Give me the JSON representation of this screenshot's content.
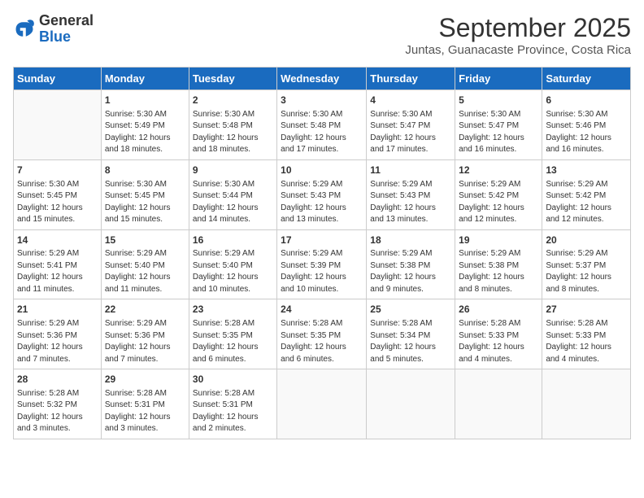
{
  "header": {
    "logo_line1": "General",
    "logo_line2": "Blue",
    "title": "September 2025",
    "subtitle": "Juntas, Guanacaste Province, Costa Rica"
  },
  "days_of_week": [
    "Sunday",
    "Monday",
    "Tuesday",
    "Wednesday",
    "Thursday",
    "Friday",
    "Saturday"
  ],
  "weeks": [
    [
      {
        "day": "",
        "info": ""
      },
      {
        "day": "1",
        "info": "Sunrise: 5:30 AM\nSunset: 5:49 PM\nDaylight: 12 hours\nand 18 minutes."
      },
      {
        "day": "2",
        "info": "Sunrise: 5:30 AM\nSunset: 5:48 PM\nDaylight: 12 hours\nand 18 minutes."
      },
      {
        "day": "3",
        "info": "Sunrise: 5:30 AM\nSunset: 5:48 PM\nDaylight: 12 hours\nand 17 minutes."
      },
      {
        "day": "4",
        "info": "Sunrise: 5:30 AM\nSunset: 5:47 PM\nDaylight: 12 hours\nand 17 minutes."
      },
      {
        "day": "5",
        "info": "Sunrise: 5:30 AM\nSunset: 5:47 PM\nDaylight: 12 hours\nand 16 minutes."
      },
      {
        "day": "6",
        "info": "Sunrise: 5:30 AM\nSunset: 5:46 PM\nDaylight: 12 hours\nand 16 minutes."
      }
    ],
    [
      {
        "day": "7",
        "info": "Sunrise: 5:30 AM\nSunset: 5:45 PM\nDaylight: 12 hours\nand 15 minutes."
      },
      {
        "day": "8",
        "info": "Sunrise: 5:30 AM\nSunset: 5:45 PM\nDaylight: 12 hours\nand 15 minutes."
      },
      {
        "day": "9",
        "info": "Sunrise: 5:30 AM\nSunset: 5:44 PM\nDaylight: 12 hours\nand 14 minutes."
      },
      {
        "day": "10",
        "info": "Sunrise: 5:29 AM\nSunset: 5:43 PM\nDaylight: 12 hours\nand 13 minutes."
      },
      {
        "day": "11",
        "info": "Sunrise: 5:29 AM\nSunset: 5:43 PM\nDaylight: 12 hours\nand 13 minutes."
      },
      {
        "day": "12",
        "info": "Sunrise: 5:29 AM\nSunset: 5:42 PM\nDaylight: 12 hours\nand 12 minutes."
      },
      {
        "day": "13",
        "info": "Sunrise: 5:29 AM\nSunset: 5:42 PM\nDaylight: 12 hours\nand 12 minutes."
      }
    ],
    [
      {
        "day": "14",
        "info": "Sunrise: 5:29 AM\nSunset: 5:41 PM\nDaylight: 12 hours\nand 11 minutes."
      },
      {
        "day": "15",
        "info": "Sunrise: 5:29 AM\nSunset: 5:40 PM\nDaylight: 12 hours\nand 11 minutes."
      },
      {
        "day": "16",
        "info": "Sunrise: 5:29 AM\nSunset: 5:40 PM\nDaylight: 12 hours\nand 10 minutes."
      },
      {
        "day": "17",
        "info": "Sunrise: 5:29 AM\nSunset: 5:39 PM\nDaylight: 12 hours\nand 10 minutes."
      },
      {
        "day": "18",
        "info": "Sunrise: 5:29 AM\nSunset: 5:38 PM\nDaylight: 12 hours\nand 9 minutes."
      },
      {
        "day": "19",
        "info": "Sunrise: 5:29 AM\nSunset: 5:38 PM\nDaylight: 12 hours\nand 8 minutes."
      },
      {
        "day": "20",
        "info": "Sunrise: 5:29 AM\nSunset: 5:37 PM\nDaylight: 12 hours\nand 8 minutes."
      }
    ],
    [
      {
        "day": "21",
        "info": "Sunrise: 5:29 AM\nSunset: 5:36 PM\nDaylight: 12 hours\nand 7 minutes."
      },
      {
        "day": "22",
        "info": "Sunrise: 5:29 AM\nSunset: 5:36 PM\nDaylight: 12 hours\nand 7 minutes."
      },
      {
        "day": "23",
        "info": "Sunrise: 5:28 AM\nSunset: 5:35 PM\nDaylight: 12 hours\nand 6 minutes."
      },
      {
        "day": "24",
        "info": "Sunrise: 5:28 AM\nSunset: 5:35 PM\nDaylight: 12 hours\nand 6 minutes."
      },
      {
        "day": "25",
        "info": "Sunrise: 5:28 AM\nSunset: 5:34 PM\nDaylight: 12 hours\nand 5 minutes."
      },
      {
        "day": "26",
        "info": "Sunrise: 5:28 AM\nSunset: 5:33 PM\nDaylight: 12 hours\nand 4 minutes."
      },
      {
        "day": "27",
        "info": "Sunrise: 5:28 AM\nSunset: 5:33 PM\nDaylight: 12 hours\nand 4 minutes."
      }
    ],
    [
      {
        "day": "28",
        "info": "Sunrise: 5:28 AM\nSunset: 5:32 PM\nDaylight: 12 hours\nand 3 minutes."
      },
      {
        "day": "29",
        "info": "Sunrise: 5:28 AM\nSunset: 5:31 PM\nDaylight: 12 hours\nand 3 minutes."
      },
      {
        "day": "30",
        "info": "Sunrise: 5:28 AM\nSunset: 5:31 PM\nDaylight: 12 hours\nand 2 minutes."
      },
      {
        "day": "",
        "info": ""
      },
      {
        "day": "",
        "info": ""
      },
      {
        "day": "",
        "info": ""
      },
      {
        "day": "",
        "info": ""
      }
    ]
  ]
}
